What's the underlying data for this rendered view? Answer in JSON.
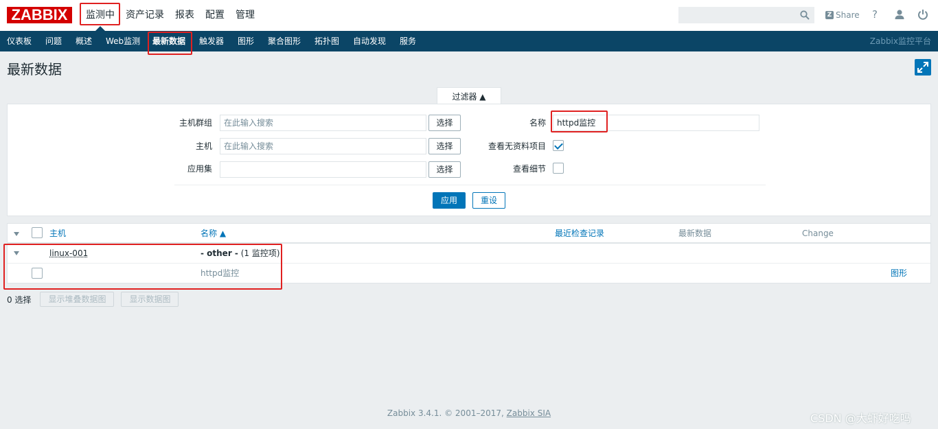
{
  "logo": "ZABBIX",
  "top_menu": [
    "监测中",
    "资产记录",
    "报表",
    "配置",
    "管理"
  ],
  "header_right": {
    "share": "Share",
    "help": "?"
  },
  "sub_menu": [
    "仪表板",
    "问题",
    "概述",
    "Web监测",
    "最新数据",
    "触发器",
    "图形",
    "聚合图形",
    "拓扑图",
    "自动发现",
    "服务"
  ],
  "sub_brand": "Zabbix监控平台",
  "page_title": "最新数据",
  "filter": {
    "tab_label": "过滤器 ▲",
    "host_group_label": "主机群组",
    "host_group_placeholder": "在此输入搜索",
    "host_label": "主机",
    "host_placeholder": "在此输入搜索",
    "app_label": "应用集",
    "app_value": "",
    "select_label": "选择",
    "name_label": "名称",
    "name_value": "httpd监控",
    "show_no_data_label": "查看无资料项目",
    "show_no_data_checked": true,
    "show_details_label": "查看细节",
    "show_details_checked": false,
    "apply_label": "应用",
    "reset_label": "重设"
  },
  "table": {
    "headers": {
      "host": "主机",
      "name": "名称 ▲",
      "last_check": "最近检查记录",
      "last_value": "最新数据",
      "change": "Change"
    },
    "group_row": {
      "host": "linux-001",
      "app_name": "- other -",
      "app_count": "(1 监控项)"
    },
    "item_row": {
      "name": "httpd监控",
      "action": "图形"
    }
  },
  "footer": {
    "selected": "0 选择",
    "stacked_graph": "显示堆叠数据图",
    "graph": "显示数据图"
  },
  "copyright": {
    "text": "Zabbix 3.4.1. © 2001–2017,",
    "link": "Zabbix SIA"
  },
  "watermark": "CSDN @大虾好吃吗",
  "colors": {
    "brand_red": "#d40000",
    "nav_blue": "#0b4566",
    "link_blue": "#0275b8",
    "highlight_red": "#e02020"
  }
}
